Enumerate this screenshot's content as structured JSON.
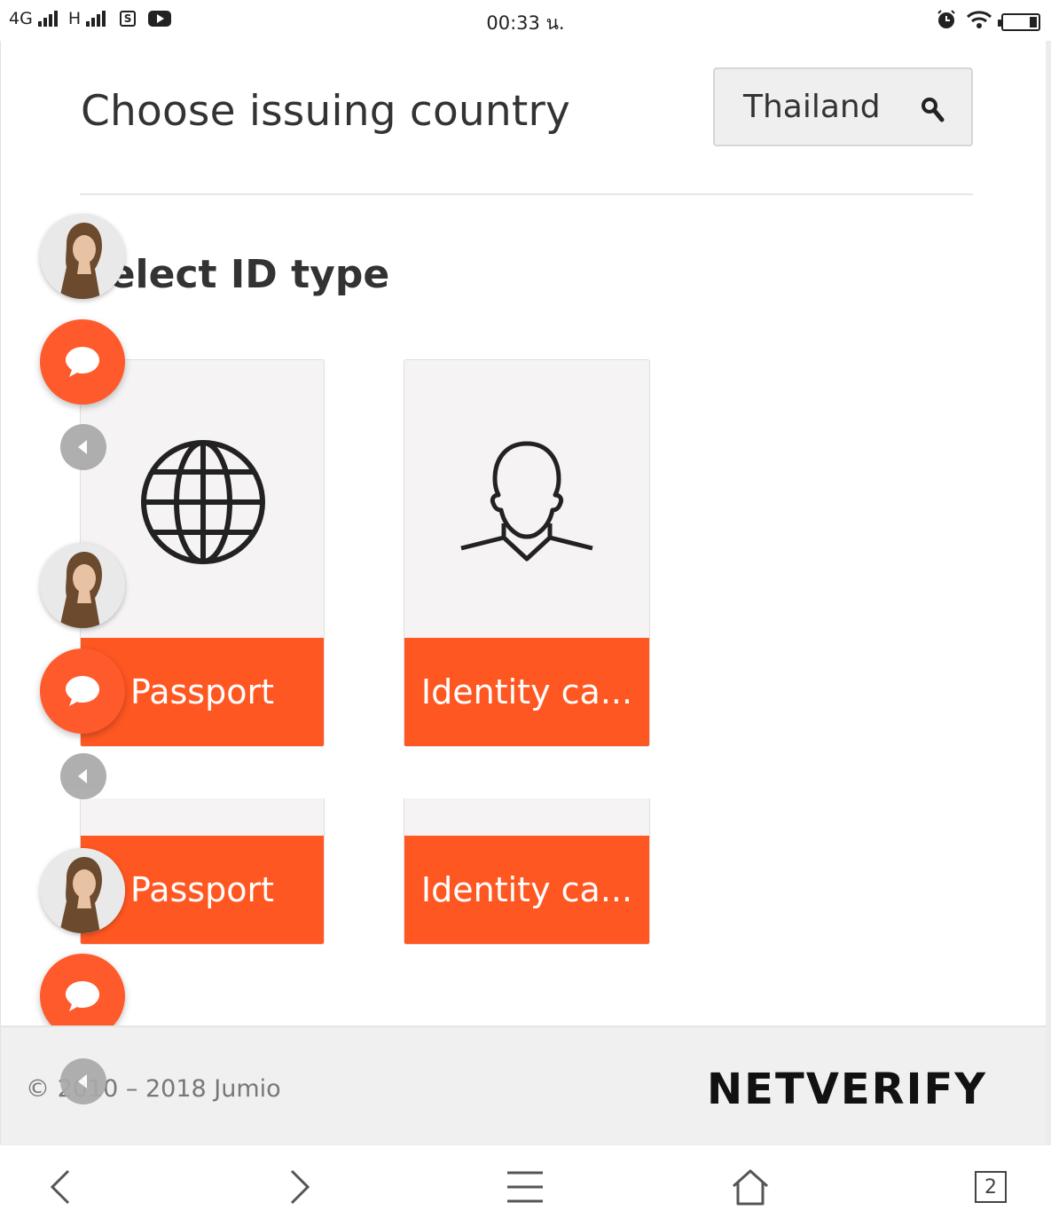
{
  "status_bar": {
    "network_1": "4G",
    "network_2": "H",
    "time": "00:33 น.",
    "icons": [
      "signal-icon",
      "sim-icon",
      "youtube-icon",
      "alarm-icon",
      "wifi-icon",
      "battery-icon"
    ]
  },
  "country": {
    "title": "Choose issuing country",
    "selected": "Thailand"
  },
  "id_type": {
    "title": "Select ID type",
    "cards": [
      {
        "label": "Passport",
        "icon": "globe-icon"
      },
      {
        "label": "Identity ca...",
        "icon": "person-silhouette-icon"
      },
      {
        "label": "Passport"
      },
      {
        "label": "Identity ca..."
      }
    ]
  },
  "footer": {
    "copyright": "© 2010 – 2018 Jumio",
    "brand": "NETVERIFY"
  },
  "bottom_nav": {
    "tab_count": "2"
  },
  "colors": {
    "accent": "#ff5722",
    "chat_button": "#ff5a2c",
    "card_bg": "#f6f3f5",
    "footer_bg": "#f0f0f0"
  }
}
